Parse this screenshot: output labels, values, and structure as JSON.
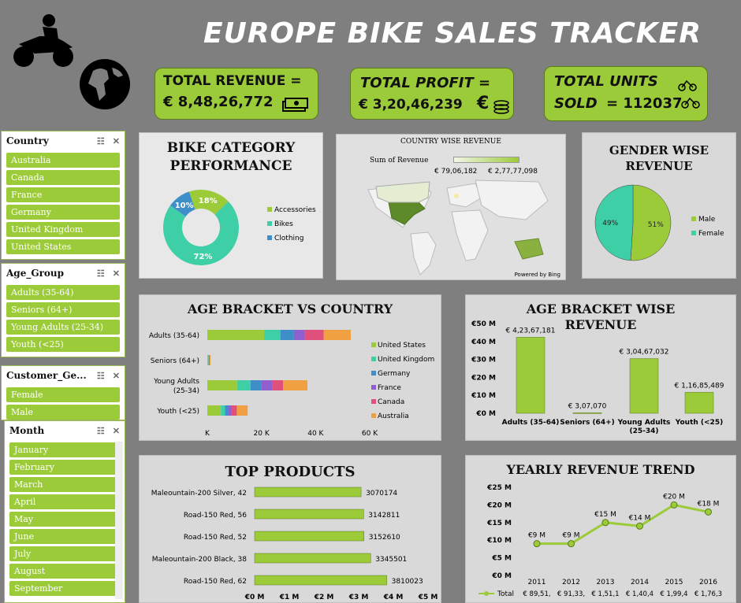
{
  "title": "EUROPE BIKE SALES TRACKER",
  "kpis": {
    "revenue": {
      "label": "TOTAL REVENUE =",
      "value": "€ 8,48,26,772"
    },
    "profit": {
      "label": "TOTAL PROFIT =",
      "value": "€ 3,20,46,239"
    },
    "units": {
      "label1": "TOTAL UNITS",
      "label2": "SOLD",
      "value": "= 112037"
    }
  },
  "slicers": {
    "country": {
      "title": "Country",
      "items": [
        "Australia",
        "Canada",
        "France",
        "Germany",
        "United Kingdom",
        "United States"
      ]
    },
    "age_group": {
      "title": "Age_Group",
      "items": [
        "Adults (35-64)",
        "Seniors (64+)",
        "Young Adults (25-34)",
        "Youth (<25)"
      ]
    },
    "customer_gender": {
      "title": "Customer_Ge...",
      "items": [
        "Female",
        "Male"
      ]
    },
    "month": {
      "title": "Month",
      "items": [
        "January",
        "February",
        "March",
        "April",
        "May",
        "June",
        "July",
        "August",
        "September"
      ]
    }
  },
  "colors": {
    "green": "#9ccb3a",
    "teal": "#3ecfa6",
    "blue": "#3e8fc9",
    "purple": "#8f5fd0",
    "pink": "#e0507a",
    "orange": "#f0a040",
    "bg": "#7f7f7f",
    "panel": "#d9d9d9"
  },
  "chart_data": [
    {
      "id": "bike-category",
      "type": "pie",
      "title": "BIKE CATEGORY PERFORMANCE",
      "labels": [
        "Accessories",
        "Bikes",
        "Clothing"
      ],
      "values": [
        18,
        72,
        10
      ],
      "value_labels": [
        "18%",
        "72%",
        "10%"
      ],
      "legend": "right"
    },
    {
      "id": "country-revenue",
      "type": "heatmap",
      "title": "COUNTRY WISE REVENUE",
      "legend_title": "Sum of Revenue",
      "range_labels": [
        "€ 79,06,182",
        "€ 2,77,77,098"
      ],
      "credit": "Powered by Bing"
    },
    {
      "id": "gender-revenue",
      "type": "pie",
      "title": "GENDER WISE REVENUE",
      "labels": [
        "Male",
        "Female"
      ],
      "values": [
        51,
        49
      ],
      "value_labels": [
        "51%",
        "49%"
      ],
      "legend": "right"
    },
    {
      "id": "age-country",
      "type": "bar",
      "orientation": "horizontal",
      "stacked": true,
      "title": "AGE BRACKET VS COUNTRY",
      "categories": [
        "Adults (35-64)",
        "Seniors (64+)",
        "Young Adults (25-34)",
        "Youth (<25)"
      ],
      "series": [
        {
          "name": "United States",
          "values": [
            21,
            0.4,
            11,
            5
          ]
        },
        {
          "name": "United Kingdom",
          "values": [
            6,
            0.1,
            5,
            1.5
          ]
        },
        {
          "name": "Germany",
          "values": [
            5,
            0.1,
            4,
            1.2
          ]
        },
        {
          "name": "France",
          "values": [
            4,
            0.1,
            4,
            1.2
          ]
        },
        {
          "name": "Canada",
          "values": [
            7,
            0.2,
            4,
            2
          ]
        },
        {
          "name": "Australia",
          "values": [
            10,
            0.3,
            9,
            4
          ]
        }
      ],
      "ticks": [
        "K",
        "20 K",
        "40 K",
        "60 K"
      ],
      "xlim": [
        0,
        60
      ],
      "legend": "right"
    },
    {
      "id": "age-revenue",
      "type": "bar",
      "title": "AGE BRACKET WISE REVENUE",
      "categories": [
        "Adults (35-64)",
        "Seniors (64+)",
        "Young Adults (25-34)",
        "Youth (<25)"
      ],
      "values": [
        42367181,
        307070,
        30467032,
        11685489
      ],
      "value_labels": [
        "€ 4,23,67,181",
        "€ 3,07,070",
        "€ 3,04,67,032",
        "€ 1,16,85,489"
      ],
      "ticks": [
        "€50 M",
        "€40 M",
        "€30 M",
        "€20 M",
        "€10 M",
        "€0 M"
      ],
      "ylim": [
        0,
        50000000
      ]
    },
    {
      "id": "top-products",
      "type": "bar",
      "orientation": "horizontal",
      "title": "TOP PRODUCTS",
      "categories": [
        "Maleountain-200 Silver, 42",
        "Road-150 Red, 56",
        "Road-150 Red, 52",
        "Maleountain-200 Black, 38",
        "Road-150 Red, 62"
      ],
      "values": [
        3070174,
        3142811,
        3152610,
        3345501,
        3810023
      ],
      "ticks": [
        "€0 M",
        "€1 M",
        "€2 M",
        "€3 M",
        "€4 M",
        "€5 M"
      ],
      "xlim": [
        0,
        5000000
      ]
    },
    {
      "id": "yearly-trend",
      "type": "line",
      "title": "YEARLY REVENUE TREND",
      "x": [
        "2011",
        "2012",
        "2013",
        "2014",
        "2015",
        "2016"
      ],
      "series": [
        {
          "name": "Total",
          "values": [
            9,
            9,
            15,
            14,
            20,
            18
          ]
        }
      ],
      "value_labels": [
        "€9 M",
        "€9 M",
        "€15 M",
        "€14 M",
        "€20 M",
        "€18 M"
      ],
      "table_row": [
        "€ 89,51,",
        "€ 91,33,",
        "€ 1,51,1",
        "€ 1,40,4",
        "€ 1,99,4",
        "€ 1,76,3"
      ],
      "ticks": [
        "€25 M",
        "€20 M",
        "€15 M",
        "€10 M",
        "€5 M",
        "€0 M"
      ],
      "ylim": [
        0,
        25
      ]
    }
  ]
}
